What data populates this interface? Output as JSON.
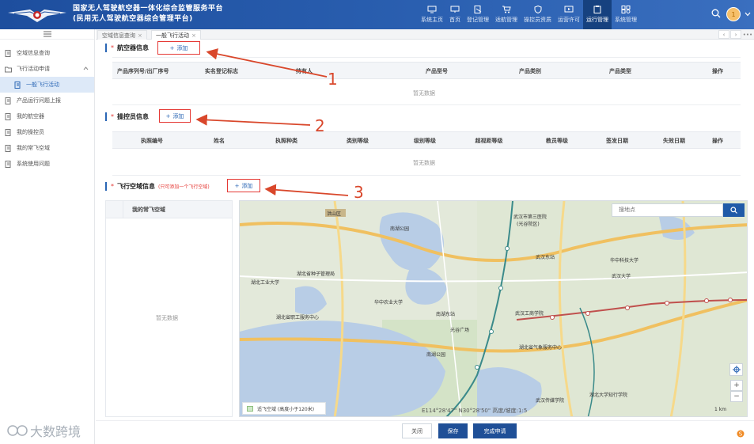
{
  "header": {
    "brand_line1": "国家无人驾驶航空器一体化综合监管服务平台",
    "brand_line2": "(民用无人驾驶航空器综合管理平台)",
    "avatar_text": "1",
    "nav": [
      {
        "label": "系统主页",
        "icon": "monitor-icon"
      },
      {
        "label": "首页",
        "icon": "desktop-icon"
      },
      {
        "label": "登记管理",
        "icon": "edit-doc-icon"
      },
      {
        "label": "适航管理",
        "icon": "cart-icon"
      },
      {
        "label": "操控员资质",
        "icon": "shield-icon"
      },
      {
        "label": "运营许可",
        "icon": "video-card-icon"
      },
      {
        "label": "运行管理",
        "icon": "clipboard-icon",
        "active": true
      },
      {
        "label": "系统管理",
        "icon": "grid-gear-icon"
      }
    ]
  },
  "sidebar": {
    "items": [
      {
        "label": "空域信息查询"
      },
      {
        "label": "飞行活动申请"
      },
      {
        "label": "一般飞行活动"
      },
      {
        "label": "产品运行问题上报"
      },
      {
        "label": "我的航空器"
      },
      {
        "label": "我的操控员"
      },
      {
        "label": "我的常飞空域"
      },
      {
        "label": "系统使用问题"
      }
    ]
  },
  "tabs": [
    {
      "label": "空域信息查询"
    },
    {
      "label": "一般飞行活动"
    }
  ],
  "aircraft": {
    "title": "航空器信息",
    "add_label": "添加",
    "columns": [
      "产品序列号/出厂序号",
      "实名登记标志",
      "持有人",
      "产品型号",
      "产品类别",
      "产品类型",
      "操作"
    ],
    "empty": "暂无数据"
  },
  "operators": {
    "title": "操控员信息",
    "add_label": "添加",
    "columns": [
      "执照编号",
      "姓名",
      "执照种类",
      "类别等级",
      "级别等级",
      "超视距等级",
      "教员等级",
      "签发日期",
      "失效日期",
      "操作"
    ],
    "empty": "暂无数据"
  },
  "airspace": {
    "title": "飞行空域信息",
    "hint": "(只可添加一个飞行空域)",
    "add_label": "添加",
    "list_header": "我的常飞空域",
    "empty": "暂无数据"
  },
  "map": {
    "search_placeholder": "搜地点",
    "legend": "适飞空域 (高度小于120米)",
    "coords": "E114°28'47\"  N30°28'50\"   高度/坡度:1:5",
    "scale": "1 km",
    "labels": [
      "洪山区",
      "南湖公园",
      "武汉市第三医院",
      "(光谷院区)",
      "武汉东站",
      "湖北工业大学",
      "湖北省种子管理局",
      "湖北省职工服务中心",
      "华中农业大学",
      "南湖东站",
      "光谷广场",
      "武汉工商学院",
      "湖北省气象服务中心",
      "南湖公园",
      "武汉传媒学院",
      "湖北大学知行学院",
      "华中科技大学",
      "武汉大学"
    ]
  },
  "annotations": [
    "1",
    "2",
    "3"
  ],
  "footer": {
    "close_label": "关闭",
    "save_label": "保存",
    "submit_label": "完成申请",
    "watermark": "大数跨境"
  },
  "colors": {
    "header": "#2a5fb0",
    "primary": "#1f4f97",
    "accent": "#2a66b5",
    "annotation": "#e53935"
  }
}
